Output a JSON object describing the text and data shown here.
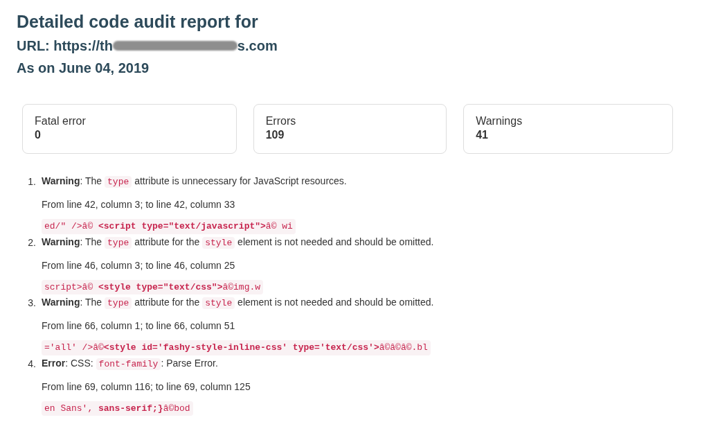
{
  "heading": {
    "title": "Detailed code audit report for",
    "url_prefix": "URL: https://th",
    "url_suffix": "s.com",
    "date": "As on June 04, 2019"
  },
  "stats": [
    {
      "label": "Fatal error",
      "value": "0"
    },
    {
      "label": "Errors",
      "value": "109"
    },
    {
      "label": "Warnings",
      "value": "41"
    }
  ],
  "issues": [
    {
      "number": "1.",
      "severity": "Warning",
      "parts": [
        {
          "kind": "text",
          "text": ": The "
        },
        {
          "kind": "code",
          "text": "type"
        },
        {
          "kind": "text",
          "text": " attribute is unnecessary for JavaScript resources."
        }
      ],
      "location": "From line 42, column 3; to line 42, column 33",
      "snippet": "ed/\" />â© **<script type=\"text/javascript\">**â© wi"
    },
    {
      "number": "2.",
      "severity": "Warning",
      "parts": [
        {
          "kind": "text",
          "text": ": The "
        },
        {
          "kind": "code",
          "text": "type"
        },
        {
          "kind": "text",
          "text": " attribute for the "
        },
        {
          "kind": "code",
          "text": "style"
        },
        {
          "kind": "text",
          "text": " element is not needed and should be omitted."
        }
      ],
      "location": "From line 46, column 3; to line 46, column 25",
      "snippet": "script>â© **<style type=\"text/css\">**â©img.w"
    },
    {
      "number": "3.",
      "severity": "Warning",
      "parts": [
        {
          "kind": "text",
          "text": ": The "
        },
        {
          "kind": "code",
          "text": "type"
        },
        {
          "kind": "text",
          "text": " attribute for the "
        },
        {
          "kind": "code",
          "text": "style"
        },
        {
          "kind": "text",
          "text": " element is not needed and should be omitted."
        }
      ],
      "location": "From line 66, column 1; to line 66, column 51",
      "snippet": "='all' />â©**<style id='fashy-style-inline-css' type='text/css'>**â©â©â©.bl"
    },
    {
      "number": "4.",
      "severity": "Error",
      "parts": [
        {
          "kind": "text",
          "text": ": CSS: "
        },
        {
          "kind": "code",
          "text": "font-family"
        },
        {
          "kind": "text",
          "text": ": Parse Error."
        }
      ],
      "location": "From line 69, column 116; to line 69, column 125",
      "snippet": "en Sans', **sans-serif;}**â©bod"
    }
  ]
}
